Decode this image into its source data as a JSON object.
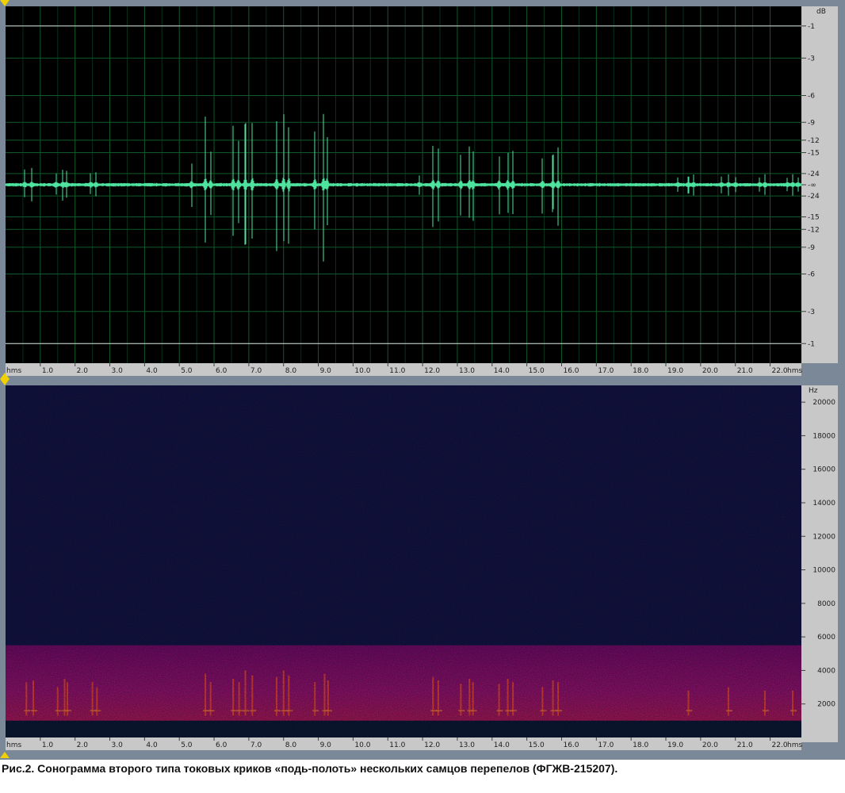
{
  "caption": "Рис.2. Сонограмма второго типа токовых криков «подь-полоть» нескольких самцов перепелов (ФГЖВ-215207).",
  "colors": {
    "waveform": "#4fe3a0",
    "wave_bg": "#000000",
    "grid": "#0f5a2a",
    "clip_line": "#d8d8d8",
    "spec_bg": "#121447",
    "spec_band": "#8a1078",
    "spec_hot": "#ff5030",
    "ruler": "#c8c8c8"
  },
  "chart_data": [
    {
      "type": "line",
      "kind": "waveform",
      "x_unit": "hms",
      "y_unit": "dB",
      "xlim": [
        0.0,
        22.9
      ],
      "x_ticks": [
        1.0,
        2.0,
        3.0,
        4.0,
        5.0,
        6.0,
        7.0,
        8.0,
        9.0,
        10.0,
        11.0,
        12.0,
        13.0,
        14.0,
        15.0,
        16.0,
        17.0,
        18.0,
        19.0,
        20.0,
        21.0,
        22.0
      ],
      "x_tick_labels": [
        "1.0",
        "2.0",
        "3.0",
        "4.0",
        "5.0",
        "6.0",
        "7.0",
        "8.0",
        "9.0",
        "10.0",
        "11.0",
        "12.0",
        "13.0",
        "14.0",
        "15.0",
        "16.0",
        "17.0",
        "18.0",
        "19.0",
        "20.0",
        "21.0",
        "22.0"
      ],
      "x_end_labels": [
        "hms",
        "hms"
      ],
      "y_ticks_label": "dB",
      "y_ticks": [
        "-1",
        "-3",
        "-6",
        "-9",
        "-12",
        "-15",
        "-24",
        "-∞",
        "-24",
        "-15",
        "-12",
        "-9",
        "-6",
        "-3",
        "-1"
      ],
      "y_tick_amplitudes": [
        0.89,
        0.71,
        0.5,
        0.35,
        0.25,
        0.18,
        0.063,
        0.0,
        -0.063,
        -0.18,
        -0.25,
        -0.35,
        -0.5,
        -0.71,
        -0.89
      ],
      "grid": true,
      "baseline_noise": 0.006,
      "spikes": [
        [
          0.55,
          0.09
        ],
        [
          0.75,
          0.1
        ],
        [
          1.45,
          0.08
        ],
        [
          1.65,
          0.1
        ],
        [
          1.75,
          0.09
        ],
        [
          2.45,
          0.08
        ],
        [
          2.6,
          0.07
        ],
        [
          5.35,
          0.15
        ],
        [
          5.75,
          0.4
        ],
        [
          5.9,
          0.22
        ],
        [
          6.55,
          0.36
        ],
        [
          6.7,
          0.28
        ],
        [
          6.9,
          0.45
        ],
        [
          7.1,
          0.4
        ],
        [
          7.8,
          0.36
        ],
        [
          8.0,
          0.45
        ],
        [
          8.15,
          0.38
        ],
        [
          8.9,
          0.33
        ],
        [
          9.15,
          0.43
        ],
        [
          9.25,
          0.34
        ],
        [
          11.9,
          0.06
        ],
        [
          12.3,
          0.25
        ],
        [
          12.45,
          0.22
        ],
        [
          13.1,
          0.2
        ],
        [
          13.35,
          0.25
        ],
        [
          13.45,
          0.22
        ],
        [
          14.2,
          0.2
        ],
        [
          14.45,
          0.23
        ],
        [
          14.6,
          0.2
        ],
        [
          15.45,
          0.18
        ],
        [
          15.75,
          0.22
        ],
        [
          15.9,
          0.22
        ],
        [
          19.35,
          0.05
        ],
        [
          19.65,
          0.06
        ],
        [
          19.8,
          0.06
        ],
        [
          20.6,
          0.05
        ],
        [
          20.8,
          0.06
        ],
        [
          21.0,
          0.05
        ],
        [
          21.7,
          0.05
        ],
        [
          21.85,
          0.06
        ],
        [
          22.5,
          0.05
        ],
        [
          22.65,
          0.06
        ],
        [
          22.8,
          0.05
        ]
      ]
    },
    {
      "type": "heatmap",
      "kind": "spectrogram",
      "x_unit": "hms",
      "y_unit": "Hz",
      "xlim": [
        0.0,
        22.9
      ],
      "ylim": [
        0,
        21000
      ],
      "x_ticks": [
        1.0,
        2.0,
        3.0,
        4.0,
        5.0,
        6.0,
        7.0,
        8.0,
        9.0,
        10.0,
        11.0,
        12.0,
        13.0,
        14.0,
        15.0,
        16.0,
        17.0,
        18.0,
        19.0,
        20.0,
        21.0,
        22.0
      ],
      "x_tick_labels": [
        "1.0",
        "2.0",
        "3.0",
        "4.0",
        "5.0",
        "6.0",
        "7.0",
        "8.0",
        "9.0",
        "10.0",
        "11.0",
        "12.0",
        "13.0",
        "14.0",
        "15.0",
        "16.0",
        "17.0",
        "18.0",
        "19.0",
        "20.0",
        "21.0",
        "22.0"
      ],
      "x_end_labels": [
        "hms",
        "hms"
      ],
      "y_ticks_label": "Hz",
      "y_ticks": [
        2000,
        4000,
        6000,
        8000,
        10000,
        12000,
        14000,
        16000,
        18000,
        20000
      ],
      "y_tick_labels": [
        "2000",
        "4000",
        "6000",
        "8000",
        "10000",
        "12000",
        "14000",
        "16000",
        "18000",
        "20000"
      ],
      "noise_band_hz": [
        1000,
        5500
      ],
      "low_band_hz": [
        0,
        1000
      ],
      "calls": [
        [
          0.6,
          3300
        ],
        [
          0.8,
          3400
        ],
        [
          1.5,
          3000
        ],
        [
          1.7,
          3500
        ],
        [
          1.78,
          3300
        ],
        [
          2.5,
          3300
        ],
        [
          2.63,
          3000
        ],
        [
          5.75,
          3800
        ],
        [
          5.9,
          3300
        ],
        [
          6.55,
          3500
        ],
        [
          6.72,
          3300
        ],
        [
          6.9,
          4000
        ],
        [
          7.1,
          3700
        ],
        [
          7.8,
          3600
        ],
        [
          8.0,
          4000
        ],
        [
          8.15,
          3700
        ],
        [
          8.9,
          3300
        ],
        [
          9.18,
          3800
        ],
        [
          9.28,
          3400
        ],
        [
          12.3,
          3600
        ],
        [
          12.45,
          3400
        ],
        [
          13.1,
          3200
        ],
        [
          13.35,
          3500
        ],
        [
          13.45,
          3300
        ],
        [
          14.2,
          3200
        ],
        [
          14.45,
          3500
        ],
        [
          14.6,
          3300
        ],
        [
          15.45,
          3000
        ],
        [
          15.75,
          3400
        ],
        [
          15.9,
          3300
        ],
        [
          19.65,
          2800
        ],
        [
          20.8,
          3000
        ],
        [
          21.85,
          2800
        ],
        [
          22.65,
          2800
        ]
      ]
    }
  ]
}
